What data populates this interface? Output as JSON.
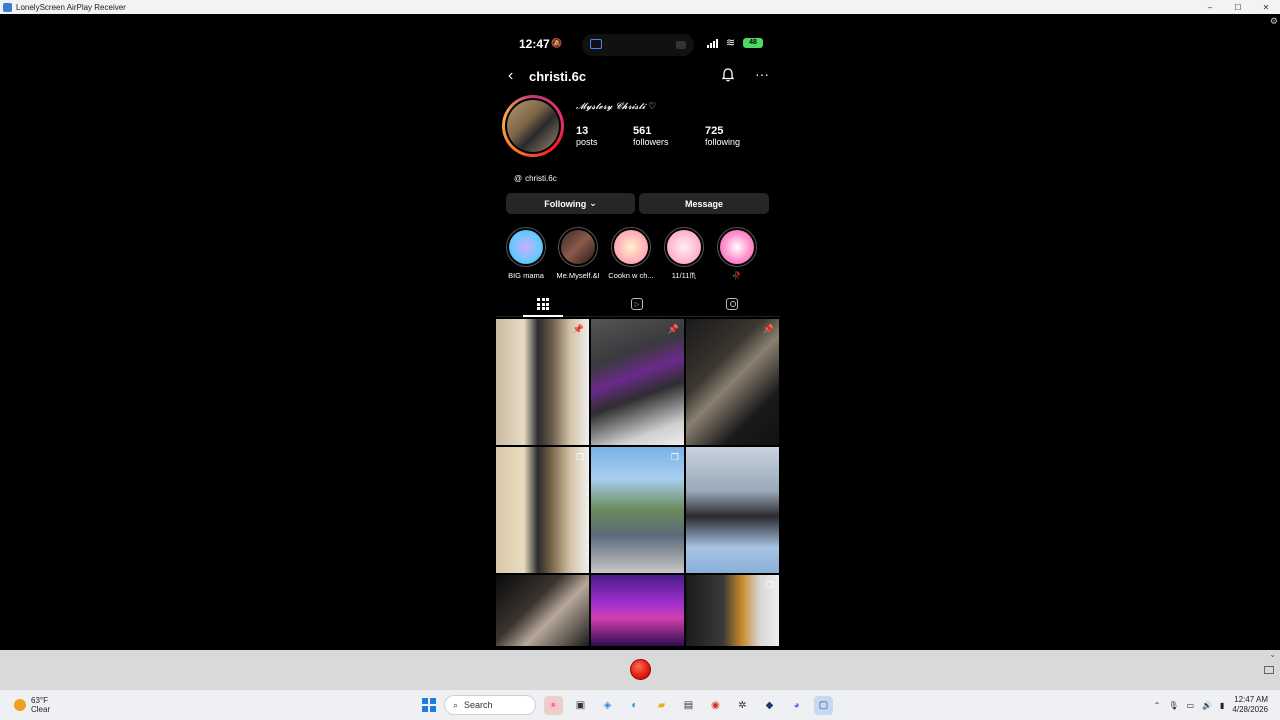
{
  "window": {
    "title": "LonelyScreen AirPlay Receiver",
    "controls": {
      "minimize": "–",
      "maximize": "☐",
      "close": "✕"
    }
  },
  "phone": {
    "status_bar": {
      "time": "12:47",
      "battery": "48"
    },
    "header": {
      "username": "christi.6c",
      "back": "‹",
      "more": "···"
    },
    "profile": {
      "display_name": "𝓜𝔂𝓼𝓽𝓮𝓻𝔂 𝓒𝓱𝓻𝓲𝓼𝓽𝓲 ♡",
      "stats": {
        "posts": {
          "count": "13",
          "label": "posts"
        },
        "followers": {
          "count": "561",
          "label": "followers"
        },
        "following": {
          "count": "725",
          "label": "following"
        }
      },
      "threads_handle": "christi.6c"
    },
    "buttons": {
      "following": "Following",
      "message": "Message"
    },
    "highlights": [
      {
        "label": "BIG mama"
      },
      {
        "label": "Me.Myself.&I"
      },
      {
        "label": "Cookn w ch..."
      },
      {
        "label": "11/11♏"
      },
      {
        "label": "🥀"
      }
    ],
    "tabs": {
      "reels_glyph": "▷"
    },
    "post_badges": {
      "pinned": "📌",
      "multi": "❐"
    }
  },
  "control_bar": {},
  "taskbar": {
    "weather": {
      "temp": "63°F",
      "condition": "Clear"
    },
    "search": "Search",
    "clock": {
      "time": "12:47 AM",
      "date": "4/28/2026"
    }
  }
}
